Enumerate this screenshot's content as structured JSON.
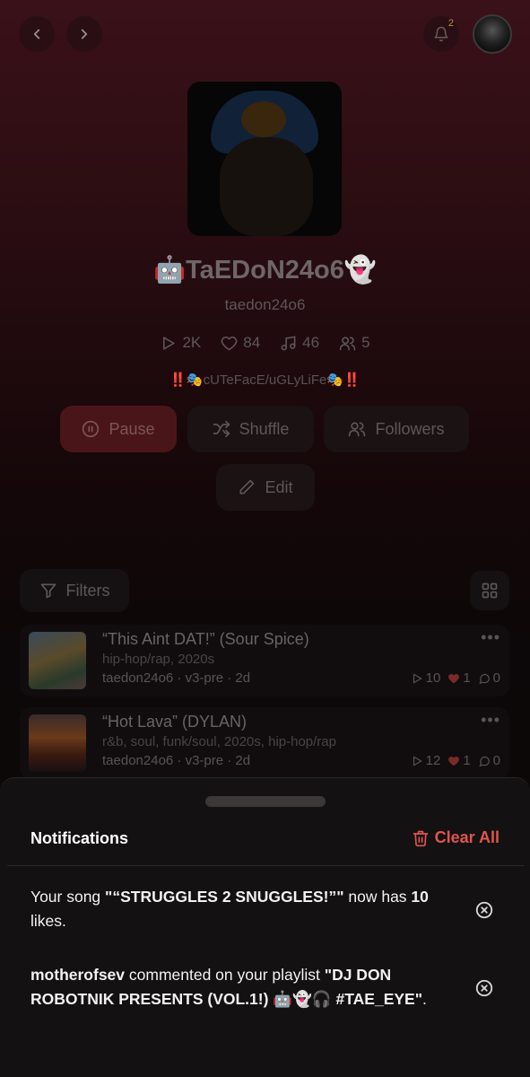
{
  "nav": {
    "back_icon": "chevron-left-icon",
    "forward_icon": "chevron-right-icon",
    "notification_count": "2"
  },
  "profile": {
    "display_name": "🤖TaEDoN24o6👻",
    "handle": "taedon24o6",
    "stats": {
      "plays": "2K",
      "likes": "84",
      "songs": "46",
      "followers": "5"
    },
    "bio": "‼️🎭cUTeFacE/uGLyLiFe🎭‼️"
  },
  "actions": {
    "pause": "Pause",
    "shuffle": "Shuffle",
    "followers": "Followers",
    "edit": "Edit"
  },
  "library": {
    "filters_label": "Filters",
    "songs": [
      {
        "title": "“This Aint DAT!” (Sour Spice)",
        "genre": "hip-hop/rap, 2020s",
        "meta": "taedon24o6 · v3-pre · 2d",
        "plays": "10",
        "likes": "1",
        "comments": "0"
      },
      {
        "title": "“Hot Lava” (DYLAN)",
        "genre": "r&b, soul, funk/soul, 2020s, hip-hop/rap",
        "meta": "taedon24o6 · v3-pre · 2d",
        "plays": "12",
        "likes": "1",
        "comments": "0"
      }
    ]
  },
  "notifications": {
    "title": "Notifications",
    "clear_all": "Clear All",
    "items": [
      {
        "prefix": "Your song ",
        "song": "\"“STRUGGLES 2 SNUGGLES!”\"",
        "middle": " now has ",
        "count": "10",
        "suffix": " likes."
      },
      {
        "user": "motherofsev",
        "middle": " commented on your playlist ",
        "playlist": "\"DJ DON ROBOTNIK PRESENTS (VOL.1!) 🤖👻🎧 #TAE_EYE\"",
        "suffix": "."
      }
    ]
  },
  "colors": {
    "accent": "#e0554f",
    "heart": "#7a2a2a",
    "sheet_bg": "#131111"
  }
}
